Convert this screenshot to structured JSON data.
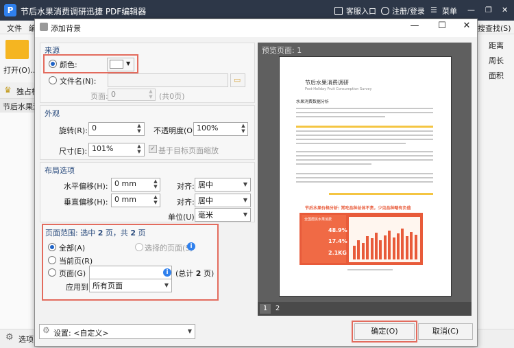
{
  "app": {
    "logo": "P",
    "title": "节后水果消费调研迅捷 PDF编辑器",
    "service": "客服入口",
    "login": "注册/登录",
    "menu": "菜单",
    "menubar": [
      "文件",
      "编"
    ],
    "find": "搜查找(S)",
    "open_label": "打开(O)...",
    "exclusive": "独占模",
    "doc_tab": "节后水果消",
    "right_tools": [
      "距离",
      "周长",
      "面积"
    ],
    "options": "选项",
    "icons": [
      "service-icon",
      "user-icon",
      "menu-icon",
      "minimize-icon",
      "maximize-icon",
      "close-icon",
      "folder-icon",
      "crown-icon",
      "gear-icon"
    ]
  },
  "dialog": {
    "title": "添加背景",
    "source": {
      "title": "来源",
      "color_label": "颜色:",
      "color_value": "#ffffff",
      "file_label": "文件名(N):",
      "page_label": "页面:",
      "page_value": "0",
      "page_total": "(共0页)"
    },
    "appearance": {
      "title": "外观",
      "rotation_label": "旋转(R):",
      "rotation_value": "0",
      "opacity_label": "不透明度(O):",
      "opacity_value": "100%",
      "size_label": "尺寸(E):",
      "size_value": "101%",
      "scale_checkbox_label": "基于目标页面缩放",
      "scale_checked": true
    },
    "layout": {
      "title": "布局选项",
      "h_offset_label": "水平偏移(H):",
      "h_offset_value": "0 mm",
      "h_align_label": "对齐:",
      "h_align_value": "居中",
      "v_offset_label": "垂直偏移(H):",
      "v_offset_value": "0 mm",
      "v_align_label": "对齐:",
      "v_align_value": "居中",
      "unit_label": "单位(U):",
      "unit_value": "毫米"
    },
    "page_range": {
      "title_prefix": "页面范围: 选中",
      "selected": "2",
      "title_mid": "页，共",
      "total": "2",
      "title_suffix": "页",
      "all_label": "全部(A)",
      "selected_pages_label": "选择的页面(S)",
      "current_label": "当前页(R)",
      "pages_label": "页面(G)",
      "pages_total_prefix": "(总计",
      "pages_total_value": "2",
      "pages_total_suffix": "页)",
      "apply_label": "应用到:",
      "apply_value": "所有页面"
    },
    "settings_label": "设置: <自定义>",
    "ok_label": "确定(O)",
    "cancel_label": "取消(C)",
    "preview": {
      "title": "预览页面: 1",
      "tabs": [
        "1",
        "2"
      ],
      "doc_title": "节后水果消费调研",
      "doc_subtitle": "Post-Holiday Fruit Consumption Survey",
      "section_title": "水果消费数据分析",
      "banner_text": "节后水果价格分析: 常吃品种总体不贵，少见品种略有负值",
      "card_title": "全国居民水果消费",
      "stats": [
        "48.9%",
        "17.4%",
        "2.1KG"
      ],
      "accent_color": "#e85b3a"
    }
  }
}
